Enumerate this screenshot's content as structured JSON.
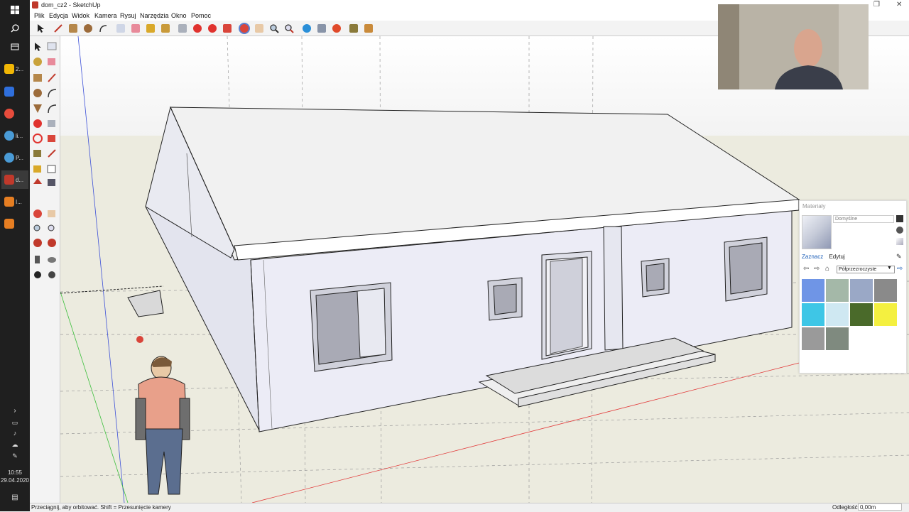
{
  "window": {
    "title": "dom_cz2 - SketchUp"
  },
  "menu": [
    "Plik",
    "Edycja",
    "Widok",
    "Kamera",
    "Rysuj",
    "Narzędzia",
    "Okno",
    "Pomoc"
  ],
  "taskbar": {
    "clock_time": "10:55",
    "clock_date": "29.04.2020",
    "apps": [
      {
        "label": "2...",
        "color": "#f2b705"
      },
      {
        "label": "li...",
        "color": "#4a9bd6"
      },
      {
        "label": "P...",
        "color": "#4a9bd6"
      },
      {
        "label": "d...",
        "color": "#c0392b"
      },
      {
        "label": "I...",
        "color": "#e67e22"
      }
    ]
  },
  "status": {
    "message": "Przeciągnij, aby orbitować. Shift = Przesunięcie kamery",
    "distance_label": "Odległość",
    "distance_value": "0,00m"
  },
  "materials": {
    "title": "Materiały",
    "material_name": "Domyślne",
    "tab_select": "Zaznacz",
    "tab_edit": "Edytuj",
    "collection": "Półprzezroczyste",
    "swatches": [
      "#6f95e6",
      "#a4b8a8",
      "#9aa8c6",
      "#8a8a8a",
      "#3ec6e6",
      "#cfe8f2",
      "#4a6a2a",
      "#f4f040",
      "#9a9a9a",
      "#7f8a7f"
    ]
  },
  "icons": {
    "start": "windows-start-icon",
    "search": "search-icon",
    "task_view": "task-view-icon"
  }
}
